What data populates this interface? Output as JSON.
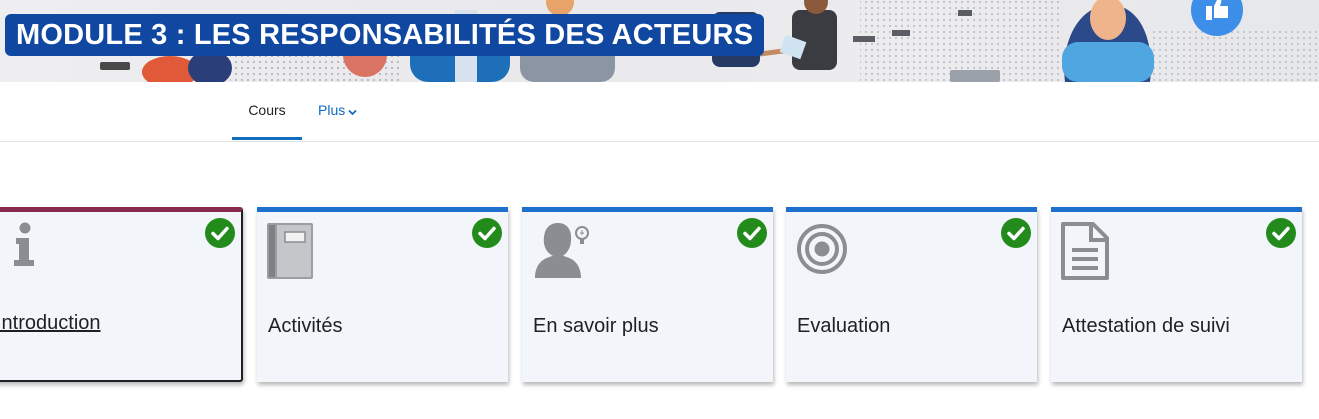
{
  "banner": {
    "title": "MODULE 3 : LES RESPONSABILITÉS DES ACTEURS"
  },
  "nav": {
    "tabs": [
      {
        "label": "Cours",
        "active": true
      },
      {
        "label": "Plus",
        "has_dropdown": true
      }
    ]
  },
  "sections": [
    {
      "label": "Introduction",
      "icon": "info-icon",
      "completed": true,
      "current": true
    },
    {
      "label": "Activités",
      "icon": "notebook-icon",
      "completed": true
    },
    {
      "label": "En savoir plus",
      "icon": "person-idea-icon",
      "completed": true
    },
    {
      "label": "Evaluation",
      "icon": "target-icon",
      "completed": true
    },
    {
      "label": "Attestation de suivi",
      "icon": "document-icon",
      "completed": true
    }
  ],
  "colors": {
    "brand_blue": "#0f47a1",
    "link_blue": "#0f6cbf",
    "card_top_border": "#1f6fcf",
    "active_card_top_border": "#8b2a4f",
    "check_green": "#238b1b",
    "icon_gray": "#8a8d91"
  }
}
